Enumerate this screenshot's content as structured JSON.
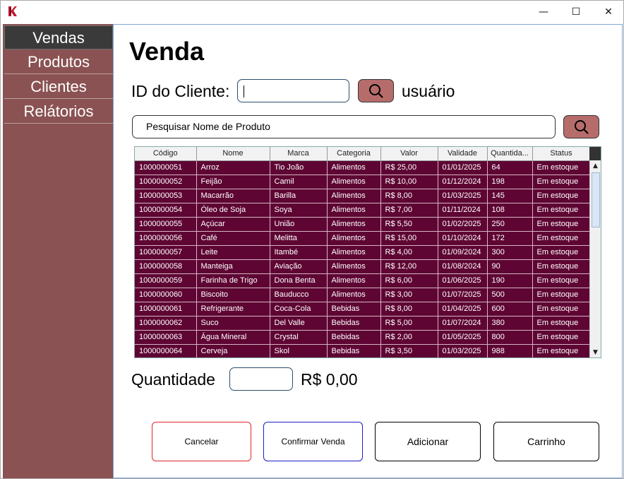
{
  "window": {
    "controls": {
      "minimize": "—",
      "maximize": "☐",
      "close": "✕"
    }
  },
  "sidebar": {
    "items": [
      {
        "label": "Vendas",
        "active": true
      },
      {
        "label": "Produtos",
        "active": false
      },
      {
        "label": "Clientes",
        "active": false
      },
      {
        "label": "Relátorios",
        "active": false
      }
    ]
  },
  "main": {
    "title": "Venda",
    "client_label": "ID do Cliente:",
    "client_value": "",
    "user_label": "usuário",
    "product_search_placeholder": "Pesquisar Nome de Produto",
    "quantity_label": "Quantidade",
    "total": "R$ 0,00"
  },
  "table": {
    "columns": [
      "Código",
      "Nome",
      "Marca",
      "Categoria",
      "Valor",
      "Validade",
      "Quantida...",
      "Status"
    ],
    "rows": [
      [
        "1000000051",
        "Arroz",
        "Tio João",
        "Alimentos",
        "R$ 25,00",
        "01/01/2025",
        "64",
        "Em estoque"
      ],
      [
        "1000000052",
        "Feijão",
        "Camil",
        "Alimentos",
        "R$ 10,00",
        "01/12/2024",
        "198",
        "Em estoque"
      ],
      [
        "1000000053",
        "Macarrão",
        "Barilla",
        "Alimentos",
        "R$ 8,00",
        "01/03/2025",
        "145",
        "Em estoque"
      ],
      [
        "1000000054",
        "Óleo de Soja",
        "Soya",
        "Alimentos",
        "R$ 7,00",
        "01/11/2024",
        "108",
        "Em estoque"
      ],
      [
        "1000000055",
        "Açúcar",
        "União",
        "Alimentos",
        "R$ 5,50",
        "01/02/2025",
        "250",
        "Em estoque"
      ],
      [
        "1000000056",
        "Café",
        "Melitta",
        "Alimentos",
        "R$ 15,00",
        "01/10/2024",
        "172",
        "Em estoque"
      ],
      [
        "1000000057",
        "Leite",
        "Itambé",
        "Alimentos",
        "R$ 4,00",
        "01/09/2024",
        "300",
        "Em estoque"
      ],
      [
        "1000000058",
        "Manteiga",
        "Aviação",
        "Alimentos",
        "R$ 12,00",
        "01/08/2024",
        "90",
        "Em estoque"
      ],
      [
        "1000000059",
        "Farinha de Trigo",
        "Dona Benta",
        "Alimentos",
        "R$ 6,00",
        "01/06/2025",
        "190",
        "Em estoque"
      ],
      [
        "1000000060",
        "Biscoito",
        "Bauducco",
        "Alimentos",
        "R$ 3,00",
        "01/07/2025",
        "500",
        "Em estoque"
      ],
      [
        "1000000061",
        "Refrigerante",
        "Coca-Cola",
        "Bebidas",
        "R$ 8,00",
        "01/04/2025",
        "600",
        "Em estoque"
      ],
      [
        "1000000062",
        "Suco",
        "Del Valle",
        "Bebidas",
        "R$ 5,00",
        "01/07/2024",
        "380",
        "Em estoque"
      ],
      [
        "1000000063",
        "Água Mineral",
        "Crystal",
        "Bebidas",
        "R$ 2,00",
        "01/05/2025",
        "800",
        "Em estoque"
      ],
      [
        "1000000064",
        "Cerveja",
        "Skol",
        "Bebidas",
        "R$ 3,50",
        "01/03/2025",
        "988",
        "Em estoque"
      ]
    ]
  },
  "buttons": {
    "cancel": "Cancelar",
    "confirm": "Confirmar Venda",
    "add": "Adicionar",
    "cart": "Carrinho"
  },
  "colors": {
    "sidebar": "#8a5252",
    "row_bg": "#5e0533",
    "search_button": "#b76c6c",
    "cancel_border": "#e0262b",
    "confirm_border": "#1c1cc8"
  }
}
